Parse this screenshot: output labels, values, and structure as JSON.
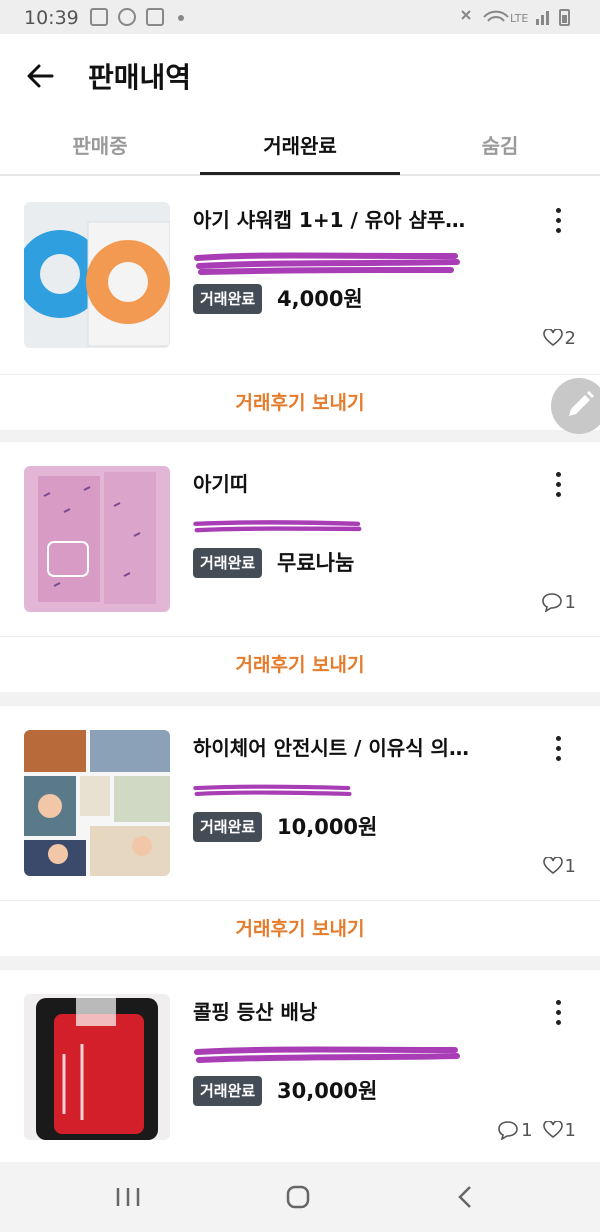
{
  "status_bar": {
    "time": "10:39",
    "right_text": "LTE"
  },
  "header": {
    "title": "판매내역"
  },
  "tabs": [
    {
      "label": "판매중"
    },
    {
      "label": "거래완료"
    },
    {
      "label": "숨김"
    }
  ],
  "items": [
    {
      "title": "아기 샤워캡 1+1 /  유아 샴푸…",
      "badge": "거래완료",
      "price": "4,000원",
      "likes": "2",
      "comments": "",
      "review_label": "거래후기 보내기"
    },
    {
      "title": "아기띠",
      "badge": "거래완료",
      "price": "무료나눔",
      "likes": "",
      "comments": "1",
      "review_label": "거래후기 보내기"
    },
    {
      "title": "하이체어 안전시트 / 이유식 의…",
      "badge": "거래완료",
      "price": "10,000원",
      "likes": "1",
      "comments": "",
      "review_label": "거래후기 보내기"
    },
    {
      "title": "콜핑 등산 배낭",
      "badge": "거래완료",
      "price": "30,000원",
      "likes": "1",
      "comments": "1",
      "review_label": ""
    }
  ],
  "colors": {
    "accent": "#e57c2c",
    "badge_bg": "#444c55",
    "scribble": "#a93db5"
  }
}
